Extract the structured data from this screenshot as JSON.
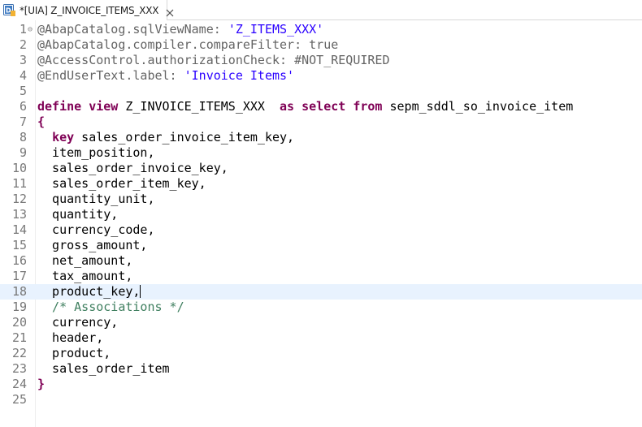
{
  "tab": {
    "title": "*[UIA] Z_INVOICE_ITEMS_XXX",
    "icon": "ddl-source-icon",
    "close_icon": "close-icon"
  },
  "editor": {
    "current_line": 18,
    "lines": [
      {
        "no": "1",
        "fold": "⊖",
        "segs": [
          [
            "ann",
            "@AbapCatalog.sqlViewName: "
          ],
          [
            "str",
            "'Z_ITEMS_XXX'"
          ]
        ]
      },
      {
        "no": "2",
        "segs": [
          [
            "ann",
            "@AbapCatalog.compiler.compareFilter: true"
          ]
        ]
      },
      {
        "no": "3",
        "segs": [
          [
            "ann",
            "@AccessControl.authorizationCheck: #NOT_REQUIRED"
          ]
        ]
      },
      {
        "no": "4",
        "segs": [
          [
            "ann",
            "@EndUserText.label: "
          ],
          [
            "str",
            "'Invoice Items'"
          ]
        ]
      },
      {
        "no": "5",
        "segs": []
      },
      {
        "no": "6",
        "segs": [
          [
            "kw",
            "define view"
          ],
          [
            "id",
            " Z_INVOICE_ITEMS_XXX  "
          ],
          [
            "kw",
            "as select from"
          ],
          [
            "id",
            " sepm_sddl_so_invoice_item"
          ]
        ]
      },
      {
        "no": "7",
        "segs": [
          [
            "brace",
            "{"
          ]
        ]
      },
      {
        "no": "8",
        "segs": [
          [
            "id",
            "  "
          ],
          [
            "kw",
            "key"
          ],
          [
            "id",
            " sales_order_invoice_item_key,"
          ]
        ]
      },
      {
        "no": "9",
        "segs": [
          [
            "id",
            "  item_position,"
          ]
        ]
      },
      {
        "no": "10",
        "segs": [
          [
            "id",
            "  sales_order_invoice_key,"
          ]
        ]
      },
      {
        "no": "11",
        "segs": [
          [
            "id",
            "  sales_order_item_key,"
          ]
        ]
      },
      {
        "no": "12",
        "segs": [
          [
            "id",
            "  quantity_unit,"
          ]
        ]
      },
      {
        "no": "13",
        "segs": [
          [
            "id",
            "  quantity,"
          ]
        ]
      },
      {
        "no": "14",
        "segs": [
          [
            "id",
            "  currency_code,"
          ]
        ]
      },
      {
        "no": "15",
        "segs": [
          [
            "id",
            "  gross_amount,"
          ]
        ]
      },
      {
        "no": "16",
        "segs": [
          [
            "id",
            "  net_amount,"
          ]
        ]
      },
      {
        "no": "17",
        "segs": [
          [
            "id",
            "  tax_amount,"
          ]
        ]
      },
      {
        "no": "18",
        "segs": [
          [
            "id",
            "  product_key,"
          ]
        ],
        "caret": true
      },
      {
        "no": "19",
        "segs": [
          [
            "cm",
            "  /* Associations */"
          ]
        ]
      },
      {
        "no": "20",
        "segs": [
          [
            "id",
            "  currency,"
          ]
        ]
      },
      {
        "no": "21",
        "segs": [
          [
            "id",
            "  header,"
          ]
        ]
      },
      {
        "no": "22",
        "segs": [
          [
            "id",
            "  product,"
          ]
        ]
      },
      {
        "no": "23",
        "segs": [
          [
            "id",
            "  sales_order_item"
          ]
        ]
      },
      {
        "no": "24",
        "segs": [
          [
            "brace",
            "}"
          ]
        ]
      },
      {
        "no": "25",
        "segs": []
      }
    ]
  },
  "colors": {
    "annotation": "#646464",
    "string": "#2a00ff",
    "keyword": "#7f0055",
    "comment": "#3f7f5f",
    "current_line_bg": "#e8f2fe"
  }
}
